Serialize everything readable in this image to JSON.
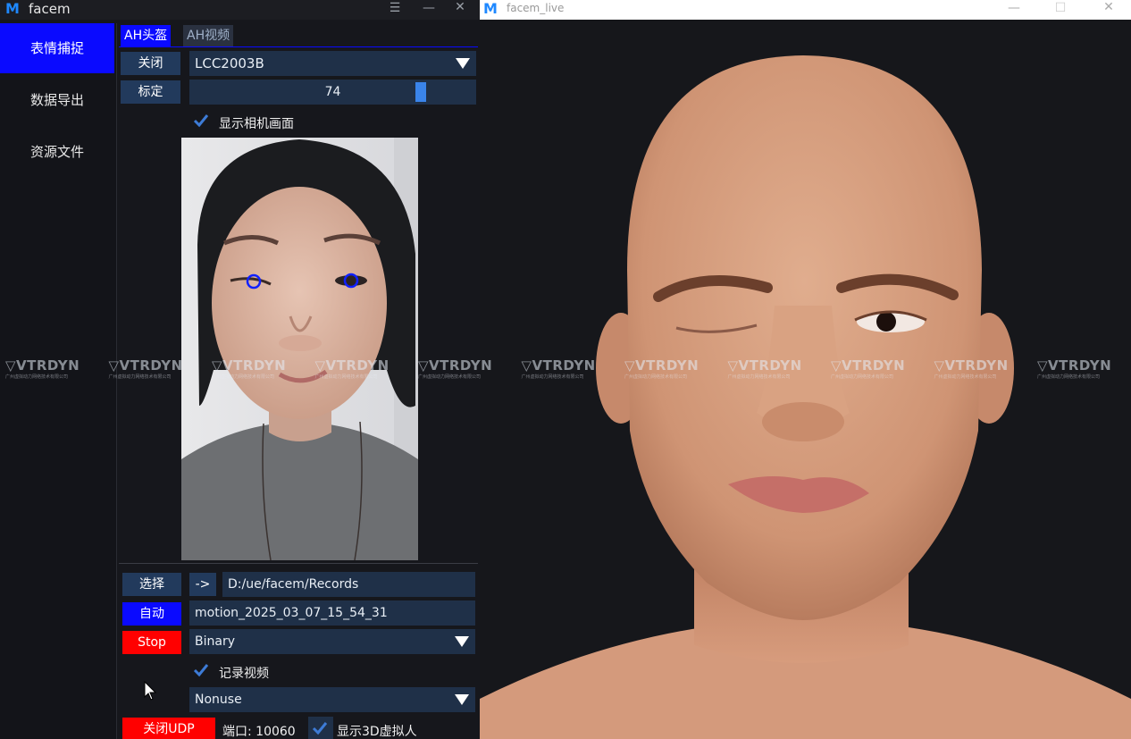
{
  "left_window": {
    "title": "facem",
    "logo": "M",
    "controls": [
      "☰",
      "—",
      "✕"
    ]
  },
  "sidebar": {
    "items": [
      {
        "label": "表情捕捉",
        "active": true
      },
      {
        "label": "数据导出",
        "active": false
      },
      {
        "label": "资源文件",
        "active": false
      }
    ]
  },
  "tabs": [
    {
      "label": "AH头盔",
      "active": true
    },
    {
      "label": "AH视频",
      "active": false
    }
  ],
  "device": {
    "close_label": "关闭",
    "device_name": "LCC2003B",
    "calibrate_label": "标定",
    "slider_value": "74",
    "slider_fraction": 0.82,
    "show_camera_label": "显示相机画面"
  },
  "recording": {
    "select_label": "选择",
    "arrow_label": "->",
    "path": "D:/ue/facem/Records",
    "auto_label": "自动",
    "filename": "motion_2025_03_07_15_54_31",
    "stop_label": "Stop",
    "format": "Binary",
    "record_video_label": "记录视频",
    "nonuse": "Nonuse",
    "udp_label": "关闭UDP",
    "port_label": "端口: 10060",
    "show_3d_label": "显示3D虚拟人"
  },
  "right_window": {
    "title": "facem_live",
    "logo": "M",
    "controls": [
      "—",
      "☐",
      "✕"
    ]
  },
  "watermark": {
    "text": "VTRDYN",
    "sub": "广州虚拟动力网络技术有限公司",
    "repeat": 11
  },
  "colors": {
    "accent_blue": "#0a0aff",
    "stop_red": "#ff0000",
    "field_bg": "#1f3048",
    "check_blue": "#3d7bd6"
  }
}
